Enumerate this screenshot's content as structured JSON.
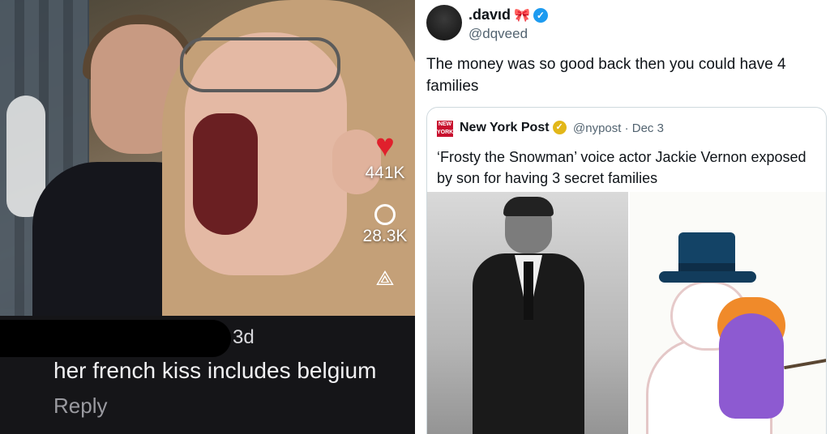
{
  "left_panel": {
    "likes_count": "441K",
    "comments_count": "28.3K",
    "comment": {
      "age": "3d",
      "text": "her french kiss includes belgium",
      "reply_label": "Reply"
    },
    "icons": [
      "heart-icon",
      "comment-icon",
      "share-icon"
    ]
  },
  "right_panel": {
    "author": {
      "display_name": ".davιd",
      "handle": "@dqveed",
      "emoji": "🎀",
      "verified": true
    },
    "tweet_text": "The money was so good back then you could have 4 families",
    "quoted": {
      "logo_text": "NEW YORK POST",
      "source_name": "New York Post",
      "handle_date": "@nypost · Dec 3",
      "text": "‘Frosty the Snowman’ voice actor Jackie Vernon exposed by son for having 3 secret families"
    }
  },
  "colors": {
    "like_red": "#e0202c",
    "twitter_blue": "#1d9bf0",
    "gold_badge": "#e2b719"
  }
}
